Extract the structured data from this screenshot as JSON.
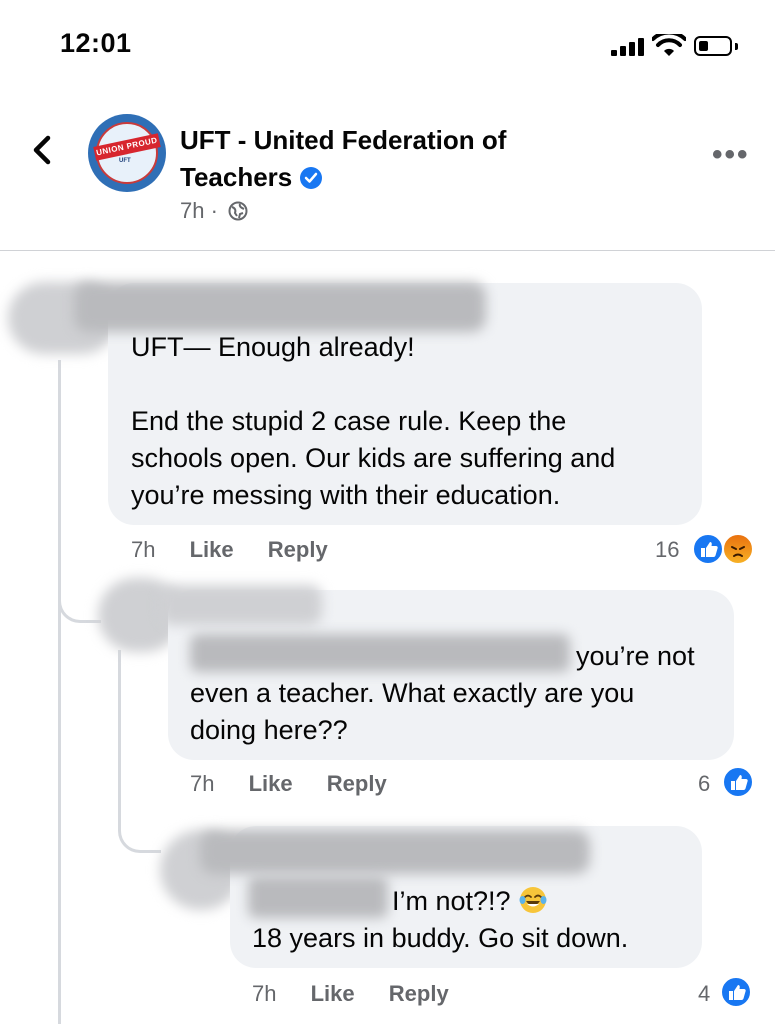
{
  "status_bar": {
    "time": "12:01"
  },
  "header": {
    "page_name_line1": "UFT - United Federation of",
    "page_name_line2": "Teachers",
    "post_age": "7h ·",
    "avatar_logo_text": "UNION PROUD",
    "avatar_logo_sub": "UFT"
  },
  "comments": [
    {
      "text_lines": [
        "UFT— Enough already!",
        "",
        "End the stupid 2 case rule.  Keep the",
        "schools open. Our kids are suffering and",
        "you’re messing with their education."
      ],
      "age": "7h",
      "like": "Like",
      "reply": "Reply",
      "reaction_count": "16",
      "reactions": [
        "like",
        "angry"
      ]
    },
    {
      "text_lines": [
        "you’re not",
        "even a teacher.  What exactly are you",
        "doing here??"
      ],
      "age": "7h",
      "like": "Like",
      "reply": "Reply",
      "reaction_count": "6",
      "reactions": [
        "like"
      ]
    },
    {
      "text_lines": [
        "I’m not?!?",
        "18 years in buddy.  Go sit down."
      ],
      "age": "7h",
      "like": "Like",
      "reply": "Reply",
      "reaction_count": "4",
      "reactions": [
        "like"
      ],
      "emoji": "tears-of-joy-emoji"
    }
  ],
  "colors": {
    "accent": "#1877f2",
    "bubble": "#f0f2f5",
    "meta": "#65676b"
  }
}
